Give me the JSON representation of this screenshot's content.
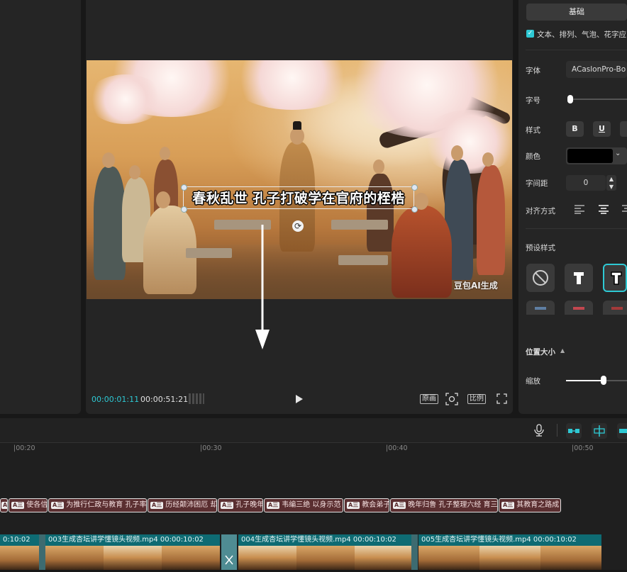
{
  "player": {
    "subtitle": "春秋乱世 孔子打破学在官府的桎梏",
    "watermark": "豆包AI生成",
    "current_time": "00:00:01:11",
    "total_time": "00:00:51:21",
    "btn_original": "原画",
    "btn_ratio": "比例"
  },
  "inspector": {
    "tab_basic": "基础",
    "checkbox_label": "文本、排列、气泡、花字应",
    "font_label": "字体",
    "font_value": "ACaslonPro-Bo",
    "size_label": "字号",
    "size_level": 0.05,
    "style_label": "样式",
    "style_bold": "B",
    "style_underline": "U",
    "color_label": "颜色",
    "color_value": "#000000",
    "spacing_label": "字间距",
    "spacing_value": "0",
    "align_label": "对齐方式",
    "preset_label": "预设样式",
    "position_label": "位置大小",
    "scale_label": "缩放",
    "scale_level": 0.62,
    "accent": "#2ec9d4"
  },
  "timeline": {
    "ticks": [
      "|00:20",
      "|00:30",
      "|00:40",
      "|00:50"
    ],
    "text_clips": [
      "使各信",
      "为推行仁政与教育 孔子率",
      "历经颠沛困厄 却",
      "孔子晚年",
      "韦编三绝 以身示范",
      "教会弟子",
      "晚年归鲁 孔子整理六经 育三",
      "其教育之路成"
    ],
    "text_tag": "A三",
    "video_clips": [
      {
        "name": "",
        "duration": "0:10:02"
      },
      {
        "name": "003生成杏坛讲学懂镜头视频.mp4",
        "duration": "00:00:10:02"
      },
      {
        "name": "004生成杏坛讲学懂镜头视频.mp4",
        "duration": "00:00:10:02"
      },
      {
        "name": "005生成杏坛讲学懂镜头视频.mp4",
        "duration": "00:00:10:02"
      }
    ]
  }
}
